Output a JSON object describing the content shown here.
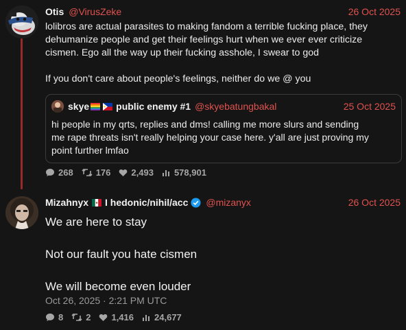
{
  "post1": {
    "name": "Otis",
    "handle": "@VirusZeke",
    "date": "26 Oct 2025",
    "text_lines": [
      "lolibros are actual parasites to making fandom a terrible fucking place, they",
      "dehumanize people and get their feelings hurt when we ever ever criticize",
      "cismen. Ego all the way up their fucking asshole, I swear to god"
    ],
    "text_line2": "If you don't care about people's feelings, neither do we @ you",
    "quote": {
      "name_prefix": "skye",
      "name_suffix": "public enemy #1",
      "handle": "@skyebatungbakal",
      "date": "25 Oct 2025",
      "text_lines": [
        "hi people in my qrts, replies and dms! calling me more slurs and sending",
        "me rape threats isn't really helping your case here. y'all are just proving my",
        "point further lmfao"
      ]
    },
    "stats": {
      "replies": "268",
      "reposts": "176",
      "likes": "2,493",
      "views": "578,901"
    }
  },
  "post2": {
    "name_prefix": "Mizahnyx",
    "name_suffix": "I hedonic/nihil/acc",
    "handle": "@mizanyx",
    "date": "26 Oct 2025",
    "paragraphs": [
      "We are here to stay",
      "Not our fault you hate cismen",
      "We will become even louder"
    ],
    "timestamp": "Oct 26, 2025 · 2:21 PM UTC",
    "stats": {
      "replies": "8",
      "reposts": "2",
      "likes": "1,416",
      "views": "24,677"
    }
  },
  "colors": {
    "background": "#151515",
    "accent": "#e0524f",
    "thread_line": "#9a2a2a",
    "verified": "#1d9bf0"
  }
}
